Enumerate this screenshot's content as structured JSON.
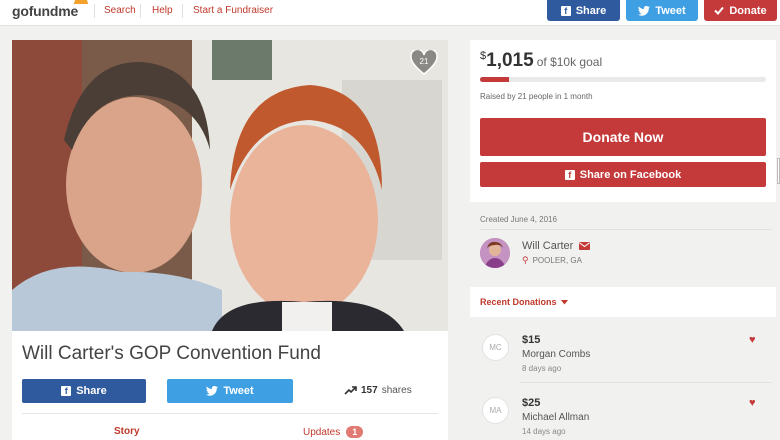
{
  "header": {
    "logo": {
      "go": "go",
      "fund": "fund",
      "me": "me"
    },
    "nav": [
      "Search",
      "Help",
      "Start a Fundraiser"
    ],
    "share_label": "Share",
    "tweet_label": "Tweet",
    "donate_label": "Donate"
  },
  "campaign": {
    "heart_count": "21",
    "title": "Will Carter's GOP Convention Fund",
    "share_label": "Share",
    "tweet_label": "Tweet",
    "shares_count": "157",
    "shares_word": "shares",
    "tabs": {
      "story": "Story",
      "updates": "Updates",
      "updates_count": "1"
    }
  },
  "goal": {
    "currency": "$",
    "amount": "1,015",
    "goal_text": "of $10k goal",
    "progress_fraction": 0.1015,
    "raised_text": "Raised by 21 people in 1 month",
    "donate_now_label": "Donate Now",
    "share_facebook_label": "Share on Facebook"
  },
  "organizer": {
    "created": "Created June 4, 2016",
    "name": "Will Carter",
    "location": "POOLER, GA"
  },
  "recent": {
    "title": "Recent Donations",
    "donations": [
      {
        "initials": "MC",
        "amount": "$15",
        "name": "Morgan Combs",
        "time": "8 days ago"
      },
      {
        "initials": "MA",
        "amount": "$25",
        "name": "Michael Allman",
        "time": "14 days ago"
      }
    ]
  },
  "colors": {
    "brand_red": "#c43a3a",
    "facebook": "#2f5a9e",
    "twitter": "#3ea0e3"
  }
}
